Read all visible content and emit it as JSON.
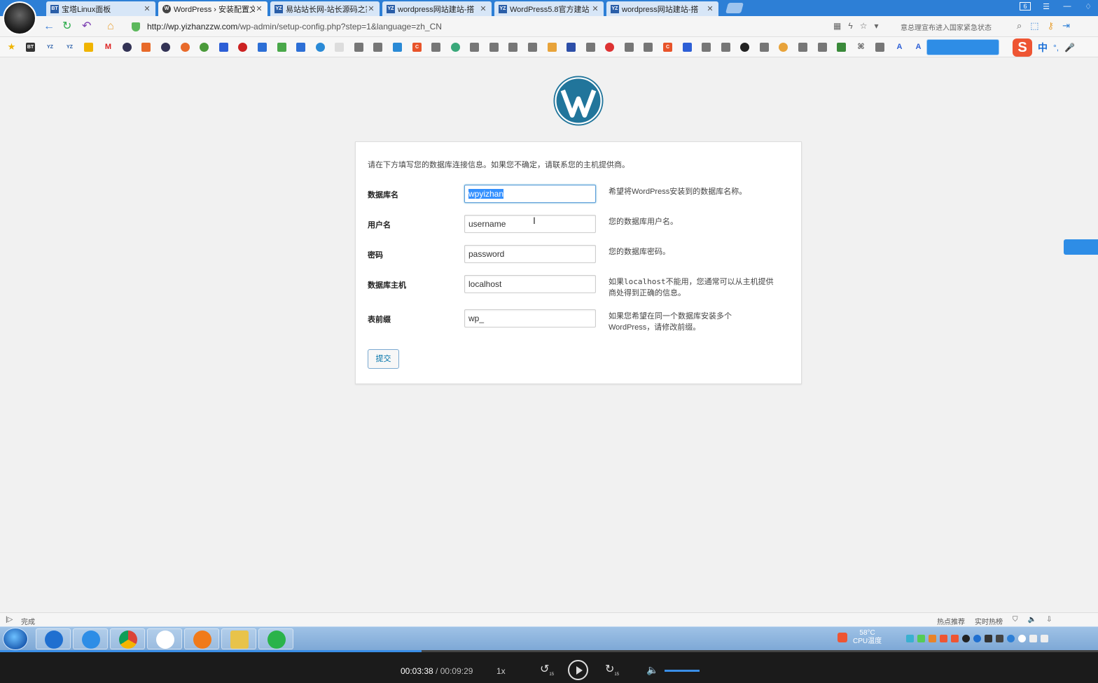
{
  "browser": {
    "tabs": [
      {
        "label": "宝塔Linux面板",
        "icon": "bt-icon",
        "active": false
      },
      {
        "label": "WordPress › 安装配置文",
        "icon": "wordpress-icon",
        "active": true
      },
      {
        "label": "易站站长网-站长源码之家",
        "icon": "yz-icon",
        "active": false
      },
      {
        "label": "wordpress网站建站-搭",
        "icon": "yz-icon",
        "active": false
      },
      {
        "label": "WordPress5.8官方建站",
        "icon": "yz-icon",
        "active": false
      },
      {
        "label": "wordpress网站建站-搭",
        "icon": "yz-icon",
        "active": false
      }
    ],
    "window_badge": "6",
    "url_host": "http://wp.yizhanzzw.com",
    "url_path": "/wp-admin/setup-config.php?step=1&language=zh_CN",
    "notice": "意总理宣布进入国家紧急状态",
    "sogou_zh": "中"
  },
  "form": {
    "intro": "请在下方填写您的数据库连接信息。如果您不确定，请联系您的主机提供商。",
    "fields": [
      {
        "label": "数据库名",
        "value": "wpyizhan",
        "desc": "希望将WordPress安装到的数据库名称。"
      },
      {
        "label": "用户名",
        "value": "username",
        "desc": "您的数据库用户名。"
      },
      {
        "label": "密码",
        "value": "password",
        "desc": "您的数据库密码。"
      },
      {
        "label": "数据库主机",
        "value": "localhost",
        "desc_code": "localhost",
        "desc_pre": "如果",
        "desc_post": "不能用，您通常可以从主机提供商处得到正确的信息。"
      },
      {
        "label": "表前缀",
        "value": "wp_",
        "desc": "如果您希望在同一个数据库安装多个WordPress，请修改前缀。"
      }
    ],
    "submit_label": "提交"
  },
  "status": {
    "text": "完成",
    "hot_recommend": "热点推荐",
    "realtime_hot": "实时热榜"
  },
  "tray": {
    "temp": "58°C",
    "temp_label": "CPU温度"
  },
  "player": {
    "current": "00:03:38",
    "separator": " / ",
    "total": "00:09:29",
    "speed": "1x",
    "back_label": "15",
    "fwd_label": "15",
    "progress": 0.384
  },
  "colors": {
    "tabbar": "#2d7fd6",
    "wp_blue": "#21759b",
    "focus_border": "#5b9dd9"
  }
}
